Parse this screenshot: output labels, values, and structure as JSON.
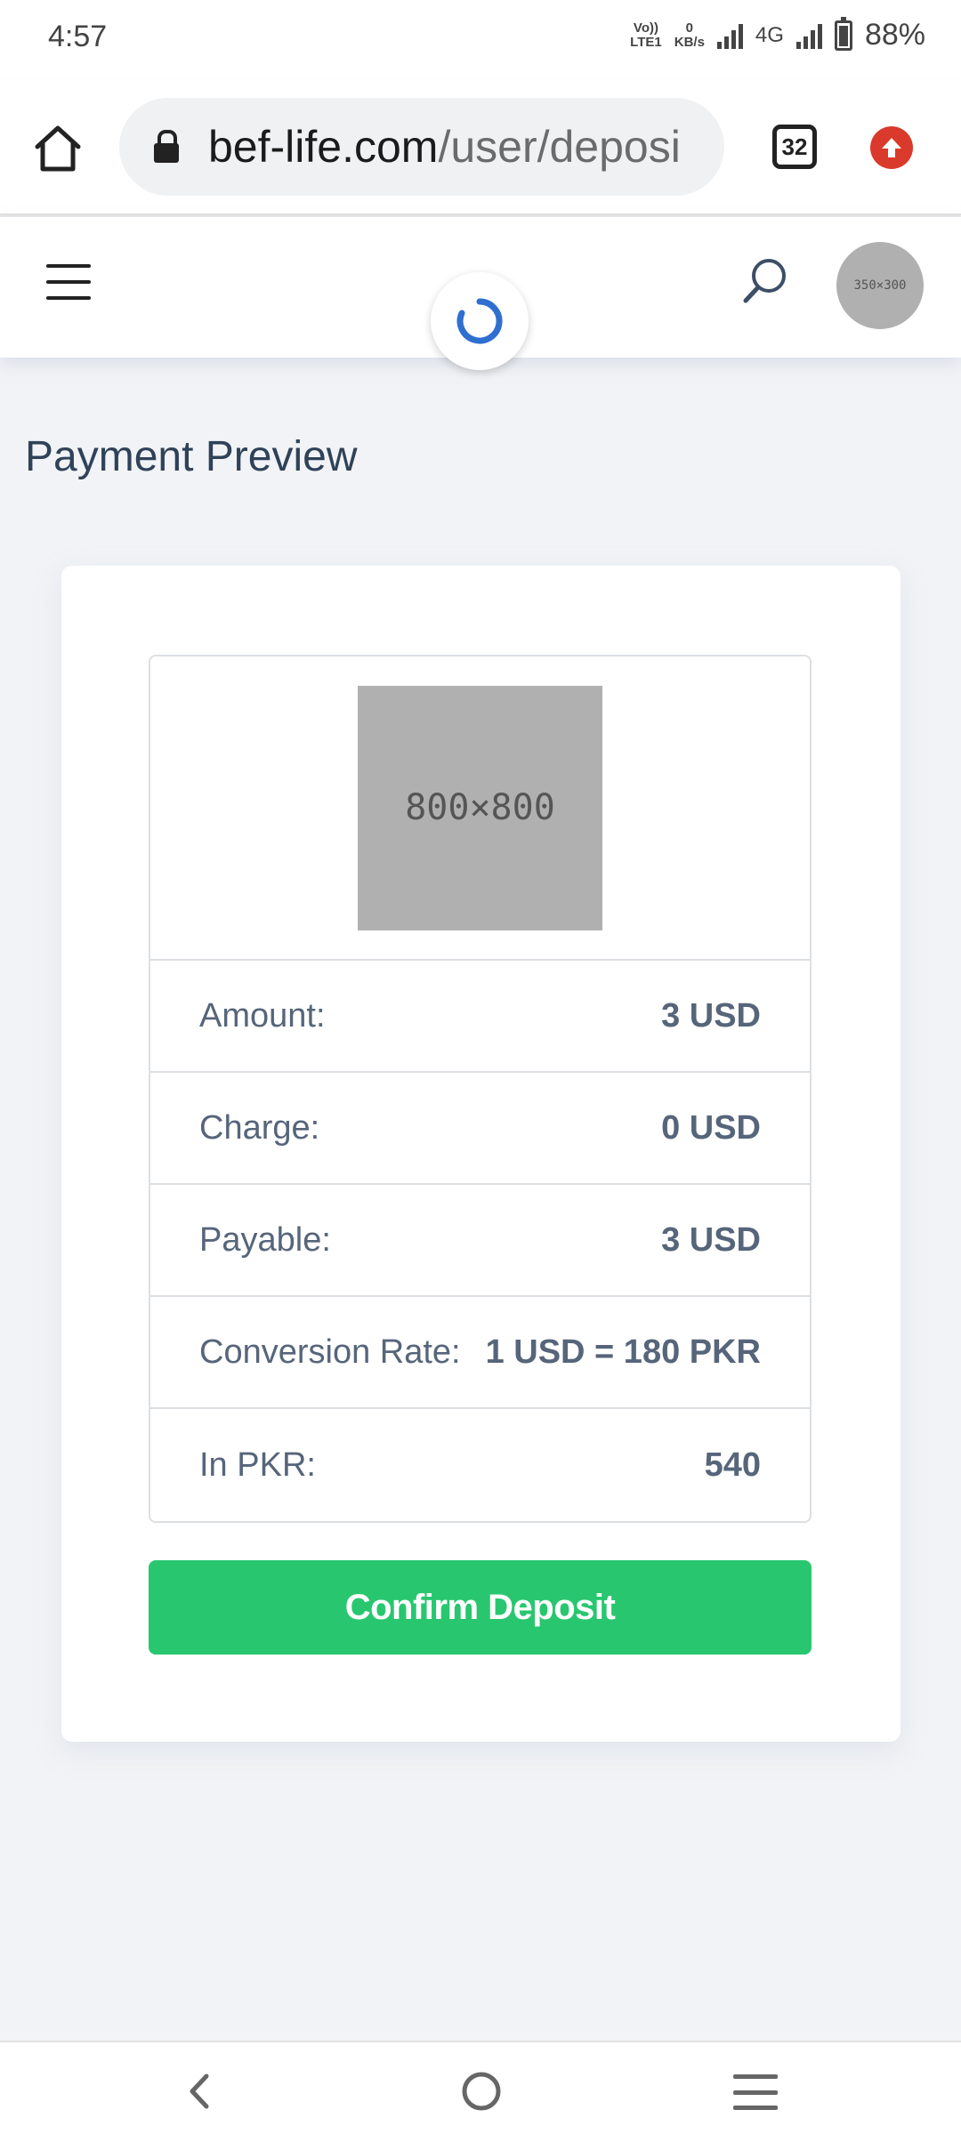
{
  "status_bar": {
    "time": "4:57",
    "volte_top": "Vo))",
    "volte_bottom": "LTE1",
    "speed_top": "0",
    "speed_bottom": "KB/s",
    "network": "4G",
    "battery_percent": "88%",
    "battery_level": 0.88
  },
  "browser": {
    "url_domain": "bef-life.com",
    "url_path": "/user/deposi",
    "tab_count": "32",
    "icons": {
      "home": "home-icon",
      "lock": "lock-icon",
      "update": "update-arrow-icon"
    }
  },
  "header": {
    "avatar_text": "350×300",
    "icons": {
      "menu": "hamburger-menu-icon",
      "search": "search-icon",
      "loading": "loading-spinner-icon"
    }
  },
  "page": {
    "title": "Payment Preview"
  },
  "payment": {
    "image_text": "800×800",
    "rows": [
      {
        "label": "Amount:",
        "value": "3 USD"
      },
      {
        "label": "Charge:",
        "value": "0 USD"
      },
      {
        "label": "Payable:",
        "value": "3 USD"
      },
      {
        "label": "Conversion Rate:",
        "value": "1 USD = 180 PKR"
      },
      {
        "label": "In PKR:",
        "value": "540"
      }
    ],
    "confirm_label": "Confirm Deposit",
    "confirm_color": "#28c76f"
  },
  "nav_bar": {
    "icons": {
      "back": "back-chevron-icon",
      "home": "home-circle-icon",
      "recents": "recents-menu-icon"
    }
  }
}
